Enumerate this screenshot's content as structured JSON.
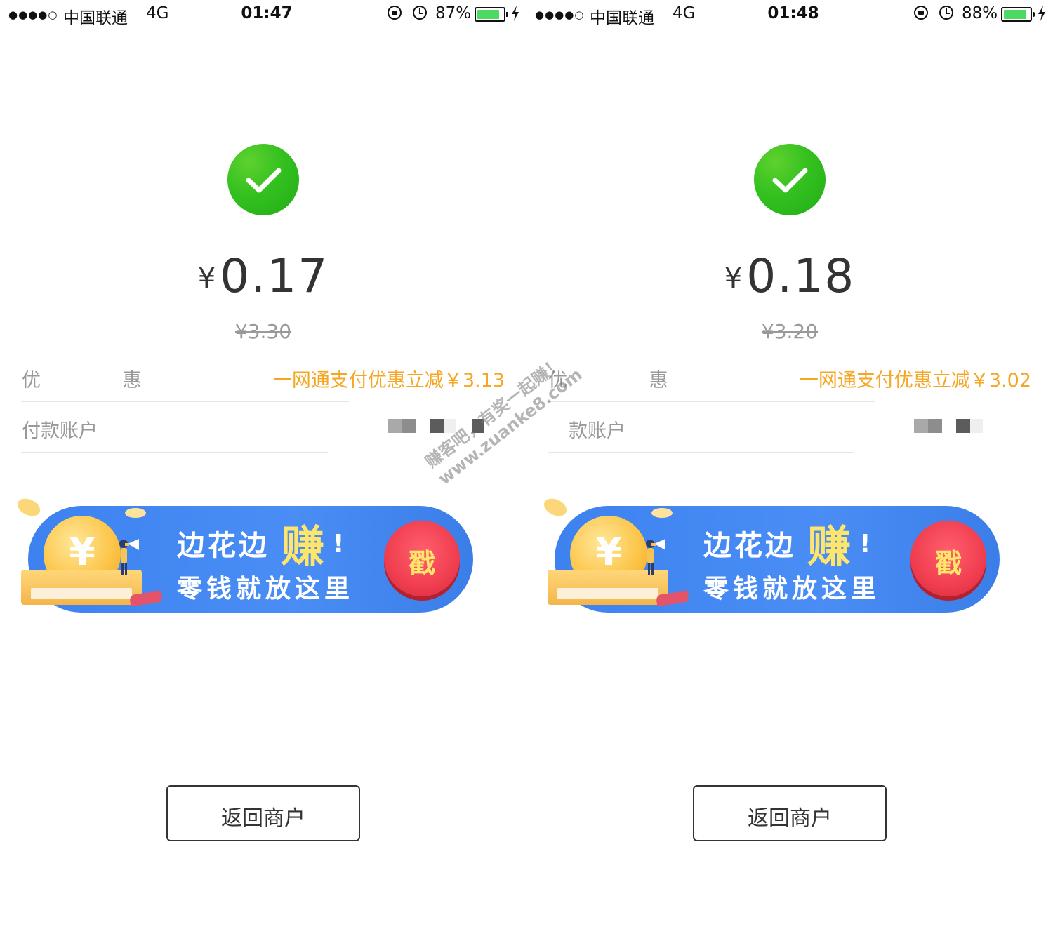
{
  "screens": [
    {
      "status": {
        "signal": "●●●●○",
        "carrier": "中国联通",
        "network": "4G",
        "time": "01:47",
        "battery_pct": "87%",
        "battery_level": 0.87
      },
      "amount": {
        "currency": "¥",
        "value": "0.17"
      },
      "original_price": "¥3.30",
      "discount": {
        "label": "优 惠",
        "value": "一网通支付优惠立减￥3.13"
      },
      "account": {
        "label": "付款账户"
      },
      "banner": {
        "line1": "边花边",
        "line1_emph": "赚",
        "line1_excl": "!",
        "line2": "零钱就放这里",
        "coin_symbol": "¥",
        "button": "戳"
      },
      "return_button": "返回商户"
    },
    {
      "status": {
        "signal": "●●●●○",
        "carrier": "中国联通",
        "network": "4G",
        "time": "01:48",
        "battery_pct": "88%",
        "battery_level": 0.88
      },
      "amount": {
        "currency": "¥",
        "value": "0.18"
      },
      "original_price": "¥3.20",
      "discount": {
        "label": "优 惠",
        "value": "一网通支付优惠立减￥3.02"
      },
      "account": {
        "label": "款账户"
      },
      "banner": {
        "line1": "边花边",
        "line1_emph": "赚",
        "line1_excl": "!",
        "line2": "零钱就放这里",
        "coin_symbol": "¥",
        "button": "戳"
      },
      "return_button": "返回商户"
    }
  ],
  "watermark": {
    "line1": "赚客吧，有奖一起赚！",
    "line2": "www.zuanke8.com"
  },
  "colors": {
    "success_green": "#34c11f",
    "discount_orange": "#f5a623",
    "banner_blue": "#4a8df5",
    "poke_red": "#f03e4f"
  }
}
